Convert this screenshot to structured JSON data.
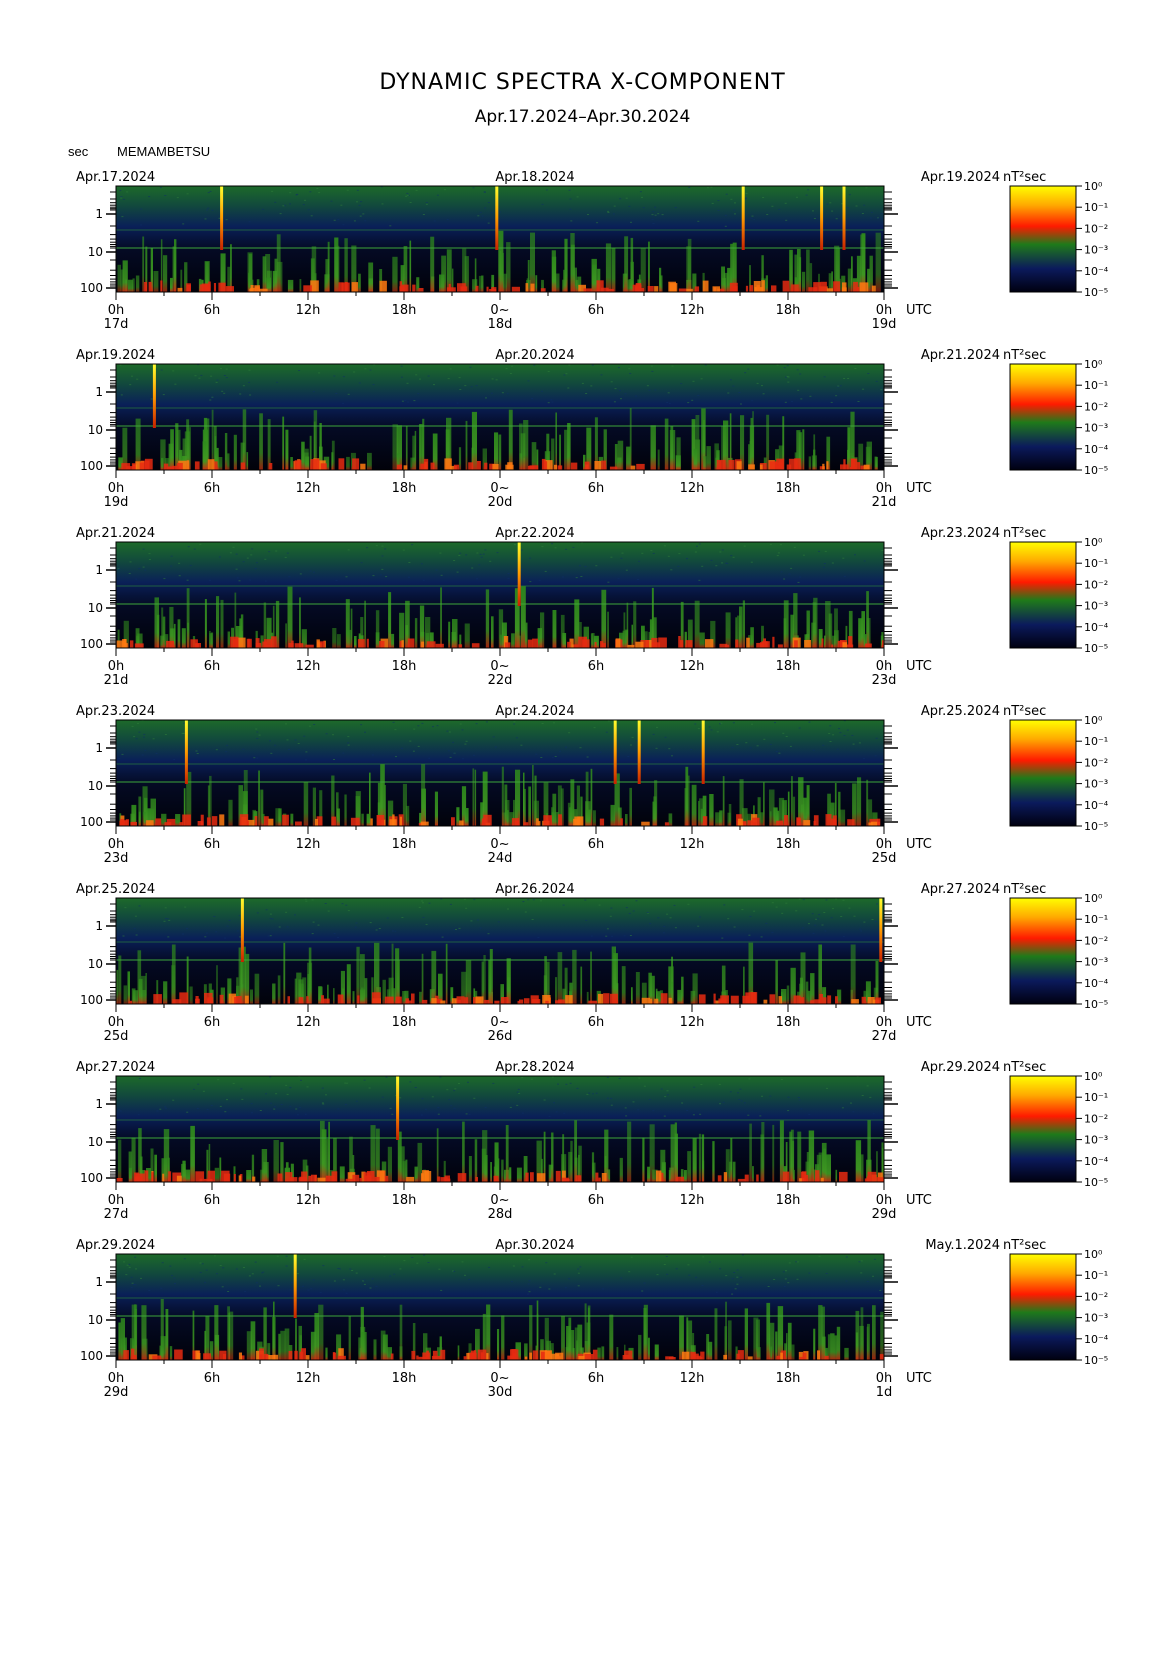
{
  "header": {
    "title": "DYNAMIC SPECTRA X-COMPONENT",
    "subtitle": "Apr.17.2024–Apr.30.2024",
    "y_unit": "sec",
    "station": "MEMAMBETSU"
  },
  "chart_data": {
    "type": "heatmap",
    "title": "DYNAMIC SPECTRA X-COMPONENT",
    "subtitle": "Apr.17.2024–Apr.30.2024",
    "ylabel": "sec",
    "yscale": "log",
    "y_ticks": [
      "1",
      "10",
      "100"
    ],
    "x_tick_labels": [
      "0h",
      "6h",
      "12h",
      "18h",
      "0~",
      "6h",
      "12h",
      "18h",
      "0h"
    ],
    "x_unit": "UTC",
    "colorbar": {
      "label": "nT²sec",
      "ticks": [
        "10⁰",
        "10⁻¹",
        "10⁻²",
        "10⁻³",
        "10⁻⁴",
        "10⁻⁵"
      ],
      "colors": [
        "#ffff00",
        "#ff9900",
        "#ff1a00",
        "#2e8b1a",
        "#0b1a5c",
        "#000018"
      ]
    },
    "panels": [
      {
        "date_left": "Apr.17.2024",
        "date_mid": "Apr.18.2024",
        "date_right": "Apr.19.2024",
        "day_labels": [
          "17d",
          "18d",
          "19d"
        ],
        "spike_hours": [
          6.6,
          23.8,
          39.2,
          44.1,
          45.5
        ]
      },
      {
        "date_left": "Apr.19.2024",
        "date_mid": "Apr.20.2024",
        "date_right": "Apr.21.2024",
        "day_labels": [
          "19d",
          "20d",
          "21d"
        ],
        "spike_hours": [
          2.4
        ]
      },
      {
        "date_left": "Apr.21.2024",
        "date_mid": "Apr.22.2024",
        "date_right": "Apr.23.2024",
        "day_labels": [
          "21d",
          "22d",
          "23d"
        ],
        "spike_hours": [
          25.2
        ]
      },
      {
        "date_left": "Apr.23.2024",
        "date_mid": "Apr.24.2024",
        "date_right": "Apr.25.2024",
        "day_labels": [
          "23d",
          "24d",
          "25d"
        ],
        "spike_hours": [
          4.4,
          31.2,
          32.7,
          36.7
        ]
      },
      {
        "date_left": "Apr.25.2024",
        "date_mid": "Apr.26.2024",
        "date_right": "Apr.27.2024",
        "day_labels": [
          "25d",
          "26d",
          "27d"
        ],
        "spike_hours": [
          7.9,
          47.8
        ]
      },
      {
        "date_left": "Apr.27.2024",
        "date_mid": "Apr.28.2024",
        "date_right": "Apr.29.2024",
        "day_labels": [
          "27d",
          "28d",
          "29d"
        ],
        "spike_hours": [
          17.6
        ]
      },
      {
        "date_left": "Apr.29.2024",
        "date_mid": "Apr.30.2024",
        "date_right": "May.1.2024",
        "day_labels": [
          "29d",
          "30d",
          "1d"
        ],
        "spike_hours": [
          11.2
        ]
      }
    ]
  }
}
